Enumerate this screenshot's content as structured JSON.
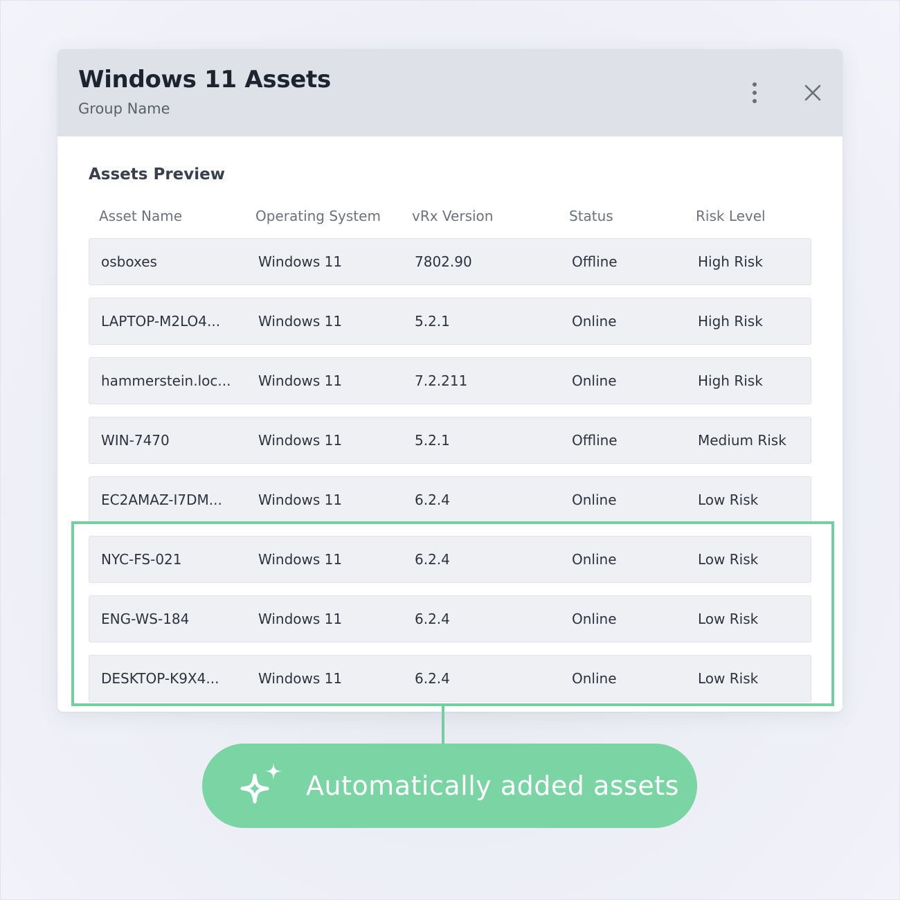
{
  "dialog": {
    "title": "Windows 11 Assets",
    "subtitle": "Group Name",
    "more_icon": "vertical-dots-icon",
    "close_icon": "close-icon"
  },
  "preview": {
    "title": "Assets Preview",
    "columns": [
      "Asset Name",
      "Operating System",
      "vRx Version",
      "Status",
      "Risk Level"
    ],
    "rows": [
      [
        "osboxes",
        "Windows 11",
        "7802.90",
        "Offline",
        "High Risk"
      ],
      [
        "LAPTOP-M2LO4...",
        "Windows 11",
        "5.2.1",
        "Online",
        "High Risk"
      ],
      [
        "hammerstein.loc...",
        "Windows 11",
        "7.2.211",
        "Online",
        "High Risk"
      ],
      [
        "WIN-7470",
        "Windows 11",
        "5.2.1",
        "Offline",
        "Medium Risk"
      ],
      [
        "EC2AMAZ-I7DM...",
        "Windows 11",
        "6.2.4",
        "Online",
        "Low Risk"
      ],
      [
        "NYC-FS-021",
        "Windows 11",
        "6.2.4",
        "Online",
        "Low Risk"
      ],
      [
        "ENG-WS-184",
        "Windows 11",
        "6.2.4",
        "Online",
        "Low Risk"
      ],
      [
        "DESKTOP-K9X4...",
        "Windows 11",
        "6.2.4",
        "Online",
        "Low Risk"
      ]
    ]
  },
  "callout": {
    "label": "Automatically added assets",
    "icon": "sparkle-icon"
  },
  "colors": {
    "accent_green": "#7ad4a3",
    "highlight_border": "#72cf9f",
    "header_bg": "#dfe1e8",
    "row_bg": "#eef0f4"
  }
}
